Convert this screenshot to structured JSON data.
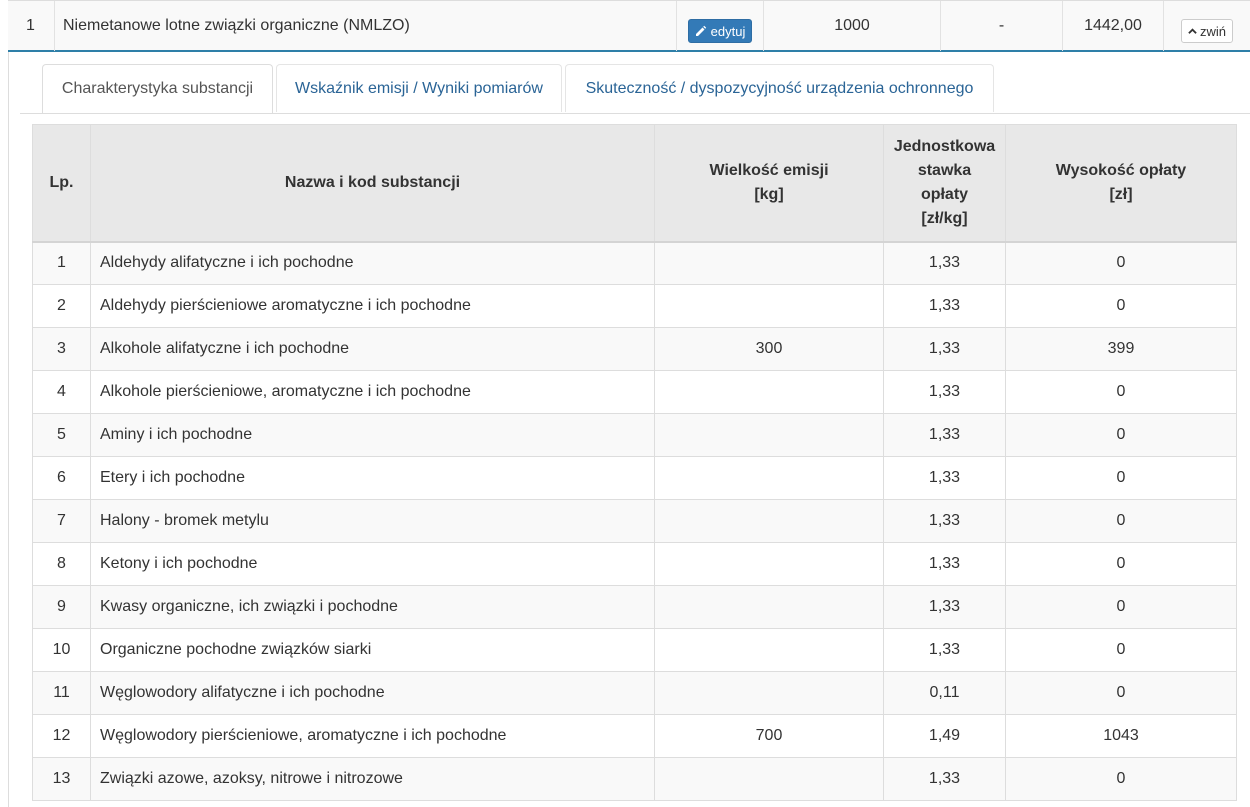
{
  "summary": {
    "number": "1",
    "name": "Niemetanowe lotne związki organiczne (NMLZO)",
    "edit_label": "edytuj",
    "value": "1000",
    "dash": "-",
    "sum": "1442,00",
    "collapse_label": "zwiń"
  },
  "tabs": [
    {
      "label": "Charakterystyka substancji",
      "active": true
    },
    {
      "label": "Wskaźnik emisji / Wyniki pomiarów",
      "active": false
    },
    {
      "label": "Skuteczność / dyspozycyjność urządzenia ochronnego",
      "active": false
    }
  ],
  "table": {
    "headers": [
      "Lp.",
      "Nazwa i kod substancji",
      "Wielkość emisji\n[kg]",
      "Jednostkowa\nstawka\nopłaty\n[zł/kg]",
      "Wysokość opłaty\n[zł]"
    ],
    "rows": [
      {
        "lp": "1",
        "name": "Aldehydy alifatyczne i ich pochodne",
        "emission": "",
        "rate": "1,33",
        "fee": "0"
      },
      {
        "lp": "2",
        "name": "Aldehydy pierścieniowe aromatyczne i ich pochodne",
        "emission": "",
        "rate": "1,33",
        "fee": "0"
      },
      {
        "lp": "3",
        "name": "Alkohole alifatyczne i ich pochodne",
        "emission": "300",
        "rate": "1,33",
        "fee": "399"
      },
      {
        "lp": "4",
        "name": "Alkohole pierścieniowe, aromatyczne i ich pochodne",
        "emission": "",
        "rate": "1,33",
        "fee": "0"
      },
      {
        "lp": "5",
        "name": "Aminy i ich pochodne",
        "emission": "",
        "rate": "1,33",
        "fee": "0"
      },
      {
        "lp": "6",
        "name": "Etery i ich pochodne",
        "emission": "",
        "rate": "1,33",
        "fee": "0"
      },
      {
        "lp": "7",
        "name": "Halony - bromek metylu",
        "emission": "",
        "rate": "1,33",
        "fee": "0"
      },
      {
        "lp": "8",
        "name": "Ketony i ich pochodne",
        "emission": "",
        "rate": "1,33",
        "fee": "0"
      },
      {
        "lp": "9",
        "name": "Kwasy organiczne, ich związki i pochodne",
        "emission": "",
        "rate": "1,33",
        "fee": "0"
      },
      {
        "lp": "10",
        "name": "Organiczne pochodne związków siarki",
        "emission": "",
        "rate": "1,33",
        "fee": "0"
      },
      {
        "lp": "11",
        "name": "Węglowodory alifatyczne i ich pochodne",
        "emission": "",
        "rate": "0,11",
        "fee": "0"
      },
      {
        "lp": "12",
        "name": "Węglowodory pierścieniowe, aromatyczne i ich pochodne",
        "emission": "700",
        "rate": "1,49",
        "fee": "1043"
      },
      {
        "lp": "13",
        "name": "Związki azowe, azoksy, nitrowe i nitrozowe",
        "emission": "",
        "rate": "1,33",
        "fee": "0"
      }
    ]
  },
  "icons": {
    "edit": "pencil-icon",
    "collapse": "chevron-up-icon"
  },
  "colors": {
    "primary": "#337ab7",
    "link": "#2a6496",
    "header_bg": "#e8e8e8",
    "accent_line": "#2e7fa8"
  }
}
